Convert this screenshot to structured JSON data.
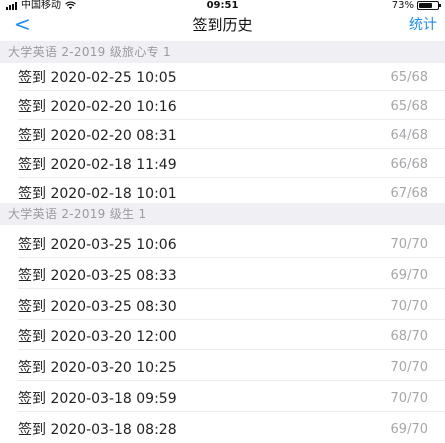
{
  "status_bar": {
    "carrier": "中国移动",
    "time": "09:51",
    "battery_percent": "73%",
    "battery_level": 0.73
  },
  "nav": {
    "back_icon": "chevron-left-icon",
    "back_glyph": "<",
    "title": "签到历史",
    "stats_label": "统计"
  },
  "sections": [
    {
      "header": "大学英语 2-2019 级旅心专 1",
      "rows": [
        {
          "label": "签到 2020-02-25 10:05",
          "count": "65/68"
        },
        {
          "label": "签到 2020-02-20 10:16",
          "count": "65/68"
        },
        {
          "label": "签到 2020-02-20 08:31",
          "count": "64/68"
        },
        {
          "label": "签到 2020-02-18 11:49",
          "count": "66/68"
        },
        {
          "label": "签到 2020-02-18 10:01",
          "count": "67/68"
        }
      ]
    },
    {
      "header": "大学英语 2-2019 级生 1",
      "rows": [
        {
          "label": "签到 2020-03-25 10:06",
          "count": "70/70"
        },
        {
          "label": "签到 2020-03-25 08:33",
          "count": "69/70"
        },
        {
          "label": "签到 2020-03-25 08:30",
          "count": "70/70"
        },
        {
          "label": "签到 2020-03-20 12:00",
          "count": "68/70"
        },
        {
          "label": "签到 2020-03-20 10:25",
          "count": "70/70"
        },
        {
          "label": "签到 2020-03-18 09:59",
          "count": "70/70"
        },
        {
          "label": "签到 2020-03-18 08:28",
          "count": "69/70"
        }
      ]
    }
  ],
  "colors": {
    "accent": "#1a8cff",
    "section_background": "#efeff4",
    "section_text": "#9a9a9f",
    "count_text": "#a7a7ab"
  }
}
